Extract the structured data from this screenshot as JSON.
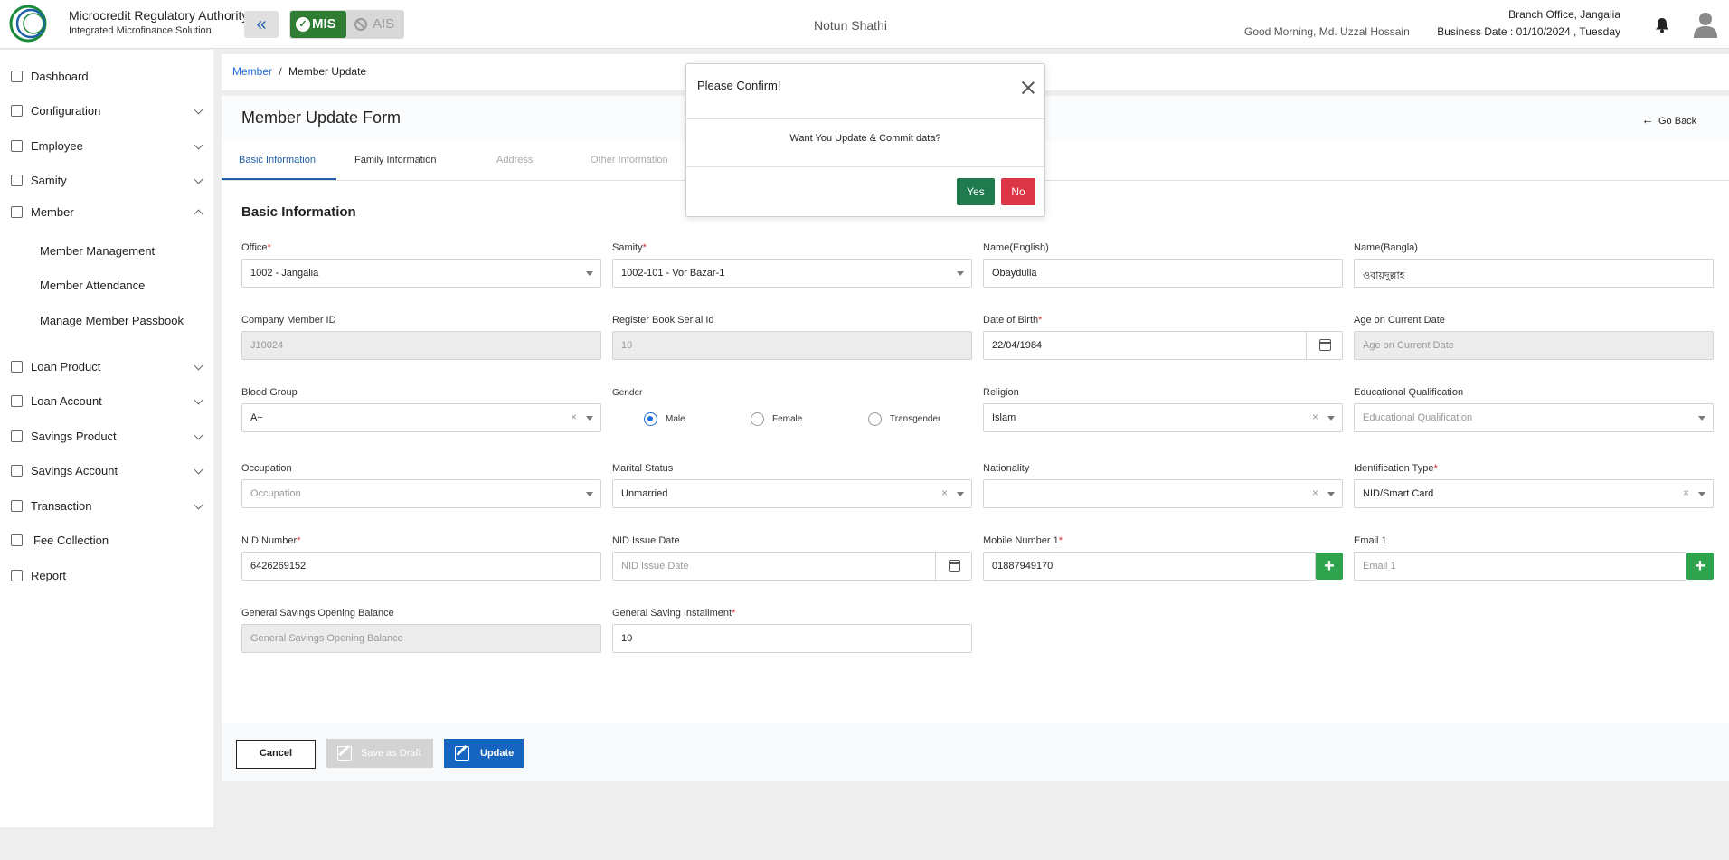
{
  "header": {
    "brand_title": "Microcredit Regulatory Authority",
    "brand_subtitle": "Integrated Microfinance Solution",
    "logo_text": "Microcredit Regulatory Authority",
    "mode_active": "MIS",
    "mode_inactive": "AIS",
    "app_name": "Notun Shathi",
    "greeting": "Good Morning, Md. Uzzal Hossain",
    "branch": "Branch Office, Jangalia",
    "business_date": "Business Date : 01/10/2024 , Tuesday",
    "colors": {
      "mis": "#2e7d32",
      "accent": "#1e5fa8"
    }
  },
  "sidebar": {
    "items": [
      {
        "label": "Dashboard",
        "icon": "dashboard-icon"
      },
      {
        "label": "Configuration",
        "icon": "config-icon"
      },
      {
        "label": "Employee",
        "icon": "employee-icon"
      },
      {
        "label": "Samity",
        "icon": "samity-icon"
      },
      {
        "label": "Member",
        "icon": "member-icon"
      },
      {
        "label": "Loan Product",
        "icon": "loan-product-icon"
      },
      {
        "label": "Loan Account",
        "icon": "loan-account-icon"
      },
      {
        "label": "Savings Product",
        "icon": "savings-product-icon"
      },
      {
        "label": "Savings Account",
        "icon": "savings-account-icon"
      },
      {
        "label": "Transaction",
        "icon": "transaction-icon"
      },
      {
        "label": "Fee Collection",
        "icon": "fee-icon"
      },
      {
        "label": "Report",
        "icon": "report-icon"
      }
    ],
    "member_sub": [
      "Member Management",
      "Member Attendance",
      "Manage Member Passbook"
    ]
  },
  "breadcrumb": {
    "parent": "Member",
    "separator": "/",
    "current": "Member Update"
  },
  "form": {
    "title": "Member Update Form",
    "go_back": "Go Back",
    "tabs": [
      "Basic Information",
      "Family Information",
      "Address",
      "Other Information"
    ],
    "section_title": "Basic Information",
    "required_mark": "*",
    "fields": {
      "office": {
        "label": "Office",
        "value": "1002 - Jangalia"
      },
      "samity": {
        "label": "Samity",
        "value": "1002-101 - Vor Bazar-1"
      },
      "name_en": {
        "label": "Name(English)",
        "value": "Obaydulla"
      },
      "name_bn": {
        "label": "Name(Bangla)",
        "value": "ওবায়দুল্লাহ"
      },
      "company_member_id": {
        "label": "Company Member ID",
        "value": "J10024"
      },
      "register_serial": {
        "label": "Register Book Serial Id",
        "value": "10"
      },
      "dob": {
        "label": "Date of Birth",
        "value": "22/04/1984"
      },
      "age": {
        "label": "Age on Current Date",
        "placeholder": "Age on Current Date"
      },
      "blood_group": {
        "label": "Blood Group",
        "value": "A+"
      },
      "gender": {
        "label": "Gender",
        "options": [
          "Male",
          "Female",
          "Transgender"
        ],
        "selected": "Male"
      },
      "religion": {
        "label": "Religion",
        "value": "Islam"
      },
      "education": {
        "label": "Educational Qualification",
        "placeholder": "Educational Qualification"
      },
      "occupation": {
        "label": "Occupation",
        "placeholder": "Occupation"
      },
      "marital_status": {
        "label": "Marital Status",
        "value": "Unmarried"
      },
      "nationality": {
        "label": "Nationality",
        "value": ""
      },
      "id_type": {
        "label": "Identification Type",
        "value": "NID/Smart Card"
      },
      "nid_number": {
        "label": "NID Number",
        "value": "6426269152"
      },
      "nid_issue_date": {
        "label": "NID Issue Date",
        "placeholder": "NID Issue Date"
      },
      "mobile1": {
        "label": "Mobile Number 1",
        "value": "01887949170"
      },
      "email1": {
        "label": "Email 1",
        "placeholder": "Email 1"
      },
      "gs_opening": {
        "label": "General Savings Opening Balance",
        "placeholder": "General Savings Opening Balance"
      },
      "gs_installment": {
        "label": "General Saving Installment",
        "value": "10"
      }
    },
    "buttons": {
      "cancel": "Cancel",
      "draft": "Save as Draft",
      "update": "Update"
    }
  },
  "modal": {
    "title": "Please Confirm!",
    "message": "Want You Update & Commit data?",
    "yes": "Yes",
    "no": "No"
  }
}
